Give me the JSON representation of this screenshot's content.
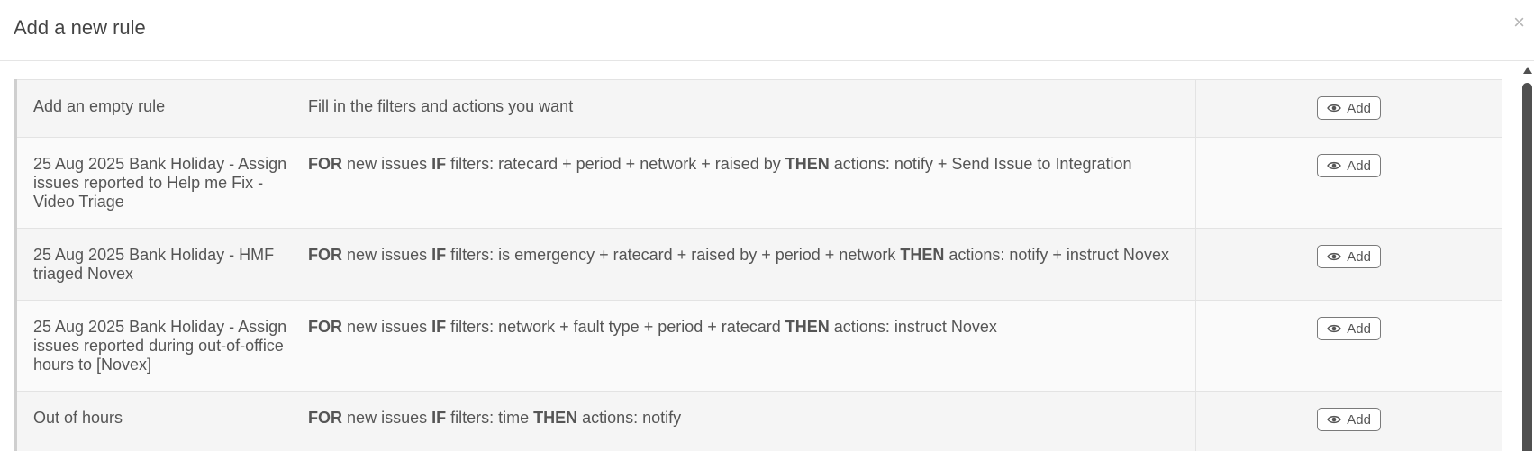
{
  "modal": {
    "title": "Add a new rule",
    "close_glyph": "×"
  },
  "keywords": {
    "for": "FOR",
    "if": "IF",
    "then": "THEN"
  },
  "add_label": "Add",
  "rules": [
    {
      "name": "Add an empty rule",
      "description": "Fill in the filters and actions you want"
    },
    {
      "name": "25 Aug 2025 Bank Holiday - Assign issues reported to Help me Fix - Video Triage",
      "target": " new issues ",
      "filters": " filters: ratecard + period + network + raised by ",
      "actions": " actions: notify + Send Issue to Integration"
    },
    {
      "name": "25 Aug 2025 Bank Holiday - HMF triaged Novex",
      "target": " new issues ",
      "filters": " filters: is emergency + ratecard + raised by + period + network ",
      "actions": " actions: notify + instruct Novex"
    },
    {
      "name": "25 Aug 2025 Bank Holiday - Assign issues reported during out-of-office hours to [Novex]",
      "target": " new issues ",
      "filters": " filters: network + fault type + period + ratecard ",
      "actions": " actions: instruct Novex"
    },
    {
      "name": "Out of hours",
      "target": " new issues ",
      "filters": " filters: time ",
      "actions": " actions: notify"
    }
  ],
  "icons": {
    "close": "close-icon",
    "add": "eye-icon"
  }
}
